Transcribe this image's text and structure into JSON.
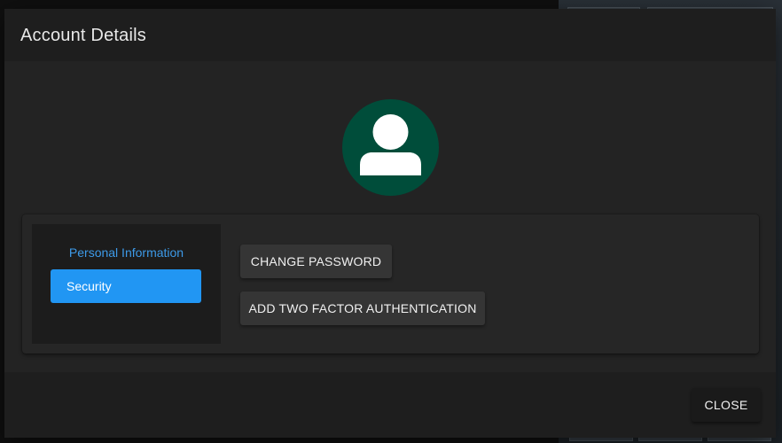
{
  "dialog": {
    "title": "Account Details"
  },
  "avatar": {
    "icon": "user-icon",
    "background_color": "#004d3a",
    "icon_color": "#ffffff"
  },
  "nav": {
    "items": [
      {
        "label": "Personal Information",
        "active": false
      },
      {
        "label": "Security",
        "active": true
      }
    ],
    "active_color": "#2196f3",
    "link_color": "#3d9ae8"
  },
  "security_actions": {
    "change_password_label": "CHANGE PASSWORD",
    "add_2fa_label": "ADD TWO FACTOR AUTHENTICATION"
  },
  "footer": {
    "close_label": "CLOSE"
  }
}
